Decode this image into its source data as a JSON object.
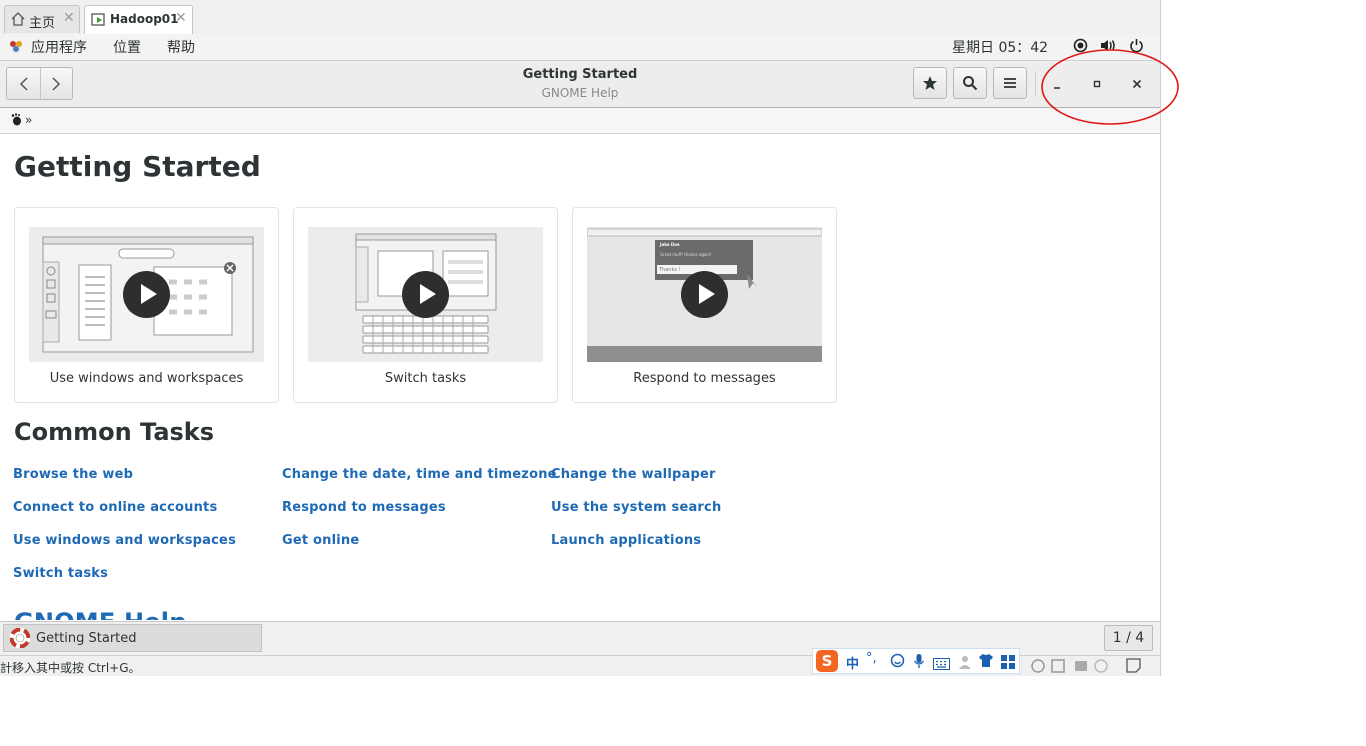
{
  "vm_tabs": [
    {
      "label": "主页",
      "icon": "home-icon"
    },
    {
      "label": "Hadoop01",
      "icon": "vm-play-icon"
    }
  ],
  "top_panel": {
    "menus": [
      "应用程序",
      "位置",
      "帮助"
    ],
    "clock": "星期日 05：42"
  },
  "header": {
    "title": "Getting Started",
    "subtitle": "GNOME Help"
  },
  "breadcrumb": {
    "separator": "»"
  },
  "page": {
    "title": "Getting Started",
    "videos": [
      {
        "label": "Use windows and workspaces"
      },
      {
        "label": "Switch tasks"
      },
      {
        "label": "Respond to messages"
      }
    ],
    "notification": {
      "sender": "Jake Doe",
      "message": "Great stuff! thanks again!",
      "reply": "Thanks !"
    },
    "common_tasks_title": "Common Tasks",
    "tasks": [
      [
        "Browse the web",
        "Connect to online accounts",
        "Use windows and workspaces",
        "Switch tasks"
      ],
      [
        "Change the date, time and timezone",
        "Respond to messages",
        "Get online"
      ],
      [
        "Change the wallpaper",
        "Use the system search",
        "Launch applications"
      ]
    ],
    "cut_heading": "GNOME Help"
  },
  "taskbar": {
    "window_label": "Getting Started",
    "workspace": "1 / 4"
  },
  "statusbar": {
    "hint": "計移入其中或按 Ctrl+G。",
    "ime_mode": "中"
  },
  "colors": {
    "link": "#1f6ab5",
    "annotation": "#e01818"
  }
}
